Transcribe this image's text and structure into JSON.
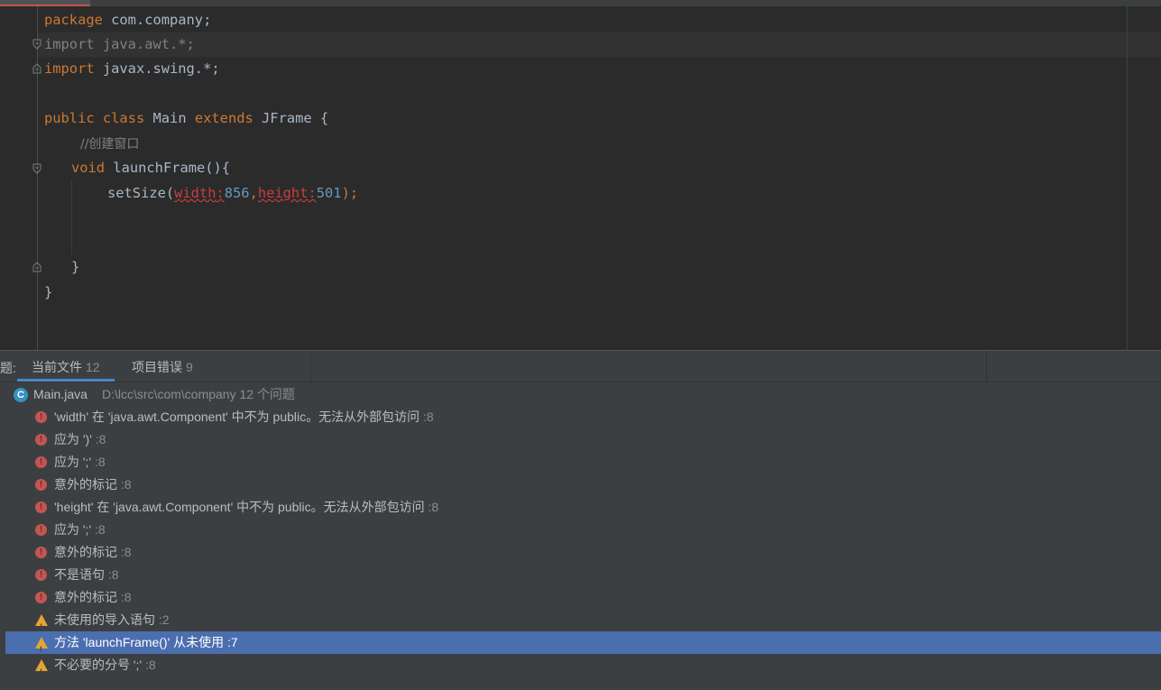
{
  "editor": {
    "lines": {
      "package_kw": "package",
      "package_name": " com.company;",
      "import1_kw": "import",
      "import1_pkg": " java.awt.*;",
      "import2_kw": "import",
      "import2_pkg": " javax.swing.*;",
      "class_public": "public",
      "class_class": "class",
      "class_name": "Main",
      "class_extends": "extends",
      "class_parent": "JFrame {",
      "comment": "//创建窗口",
      "method_void": "void",
      "method_name": " launchFrame(){",
      "call_name": "setSize(",
      "param_width": "width",
      "colon1": ":",
      "val_width": "856",
      "comma": ",",
      "param_height": "height",
      "colon2": ":",
      "val_height": "501",
      "call_end": ");",
      "close_method": "}",
      "close_class": "}"
    }
  },
  "panel": {
    "title": "题:",
    "tabs": [
      {
        "label": "当前文件",
        "count": "12"
      },
      {
        "label": "项目错误",
        "count": "9"
      }
    ],
    "file": {
      "icon": "C",
      "name": "Main.java",
      "path": "D:\\lcc\\src\\com\\company  12 个问题"
    },
    "problems": [
      {
        "type": "error",
        "text": "'width' 在 'java.awt.Component' 中不为 public。无法从外部包访问",
        "line": ":8"
      },
      {
        "type": "error",
        "text": "应为 ')'",
        "line": ":8"
      },
      {
        "type": "error",
        "text": "应为 ';'",
        "line": ":8"
      },
      {
        "type": "error",
        "text": "意外的标记",
        "line": ":8"
      },
      {
        "type": "error",
        "text": "'height' 在 'java.awt.Component' 中不为 public。无法从外部包访问",
        "line": ":8"
      },
      {
        "type": "error",
        "text": "应为 ';'",
        "line": ":8"
      },
      {
        "type": "error",
        "text": "意外的标记",
        "line": ":8"
      },
      {
        "type": "error",
        "text": "不是语句",
        "line": ":8"
      },
      {
        "type": "error",
        "text": "意外的标记",
        "line": ":8"
      },
      {
        "type": "warning",
        "text": "未使用的导入语句",
        "line": ":2"
      },
      {
        "type": "warning",
        "text": "方法 'launchFrame()' 从未使用",
        "line": ":7",
        "selected": true
      },
      {
        "type": "warning",
        "text": "不必要的分号 ';'",
        "line": ":8"
      }
    ]
  },
  "colors": {
    "keyword": "#cc7832",
    "error": "#c75450",
    "warning": "#e3a535",
    "selection": "#4b6eaf",
    "number": "#6897bb"
  }
}
